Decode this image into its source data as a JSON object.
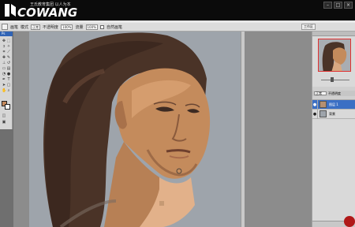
{
  "banner": {
    "logo_big": "COWANG",
    "logo_small": "王氏教育集团 以人为本"
  },
  "window_controls": [
    "–",
    "□",
    "×"
  ],
  "options_bar": {
    "items": [
      "画笔",
      "模式",
      "正常",
      "不透明度",
      "100%",
      "流量",
      "100%"
    ],
    "checkbox_label": "自然画笔",
    "workspace_label": "工作区"
  },
  "toolbox": {
    "header": "Ps",
    "foreground_color": "#c58a5d",
    "background_color": "#ffffff"
  },
  "layers_panel": {
    "blend_mode": "正常",
    "opacity_label": "不透明度",
    "layers": [
      {
        "name": "图层 1",
        "active": true
      },
      {
        "name": "背景",
        "active": false
      }
    ]
  },
  "colors": {
    "canvas_bg": "#9ea4ab",
    "skin": "#c48b5c",
    "hair": "#4a3327",
    "layer_highlight": "#3b6fc4"
  }
}
